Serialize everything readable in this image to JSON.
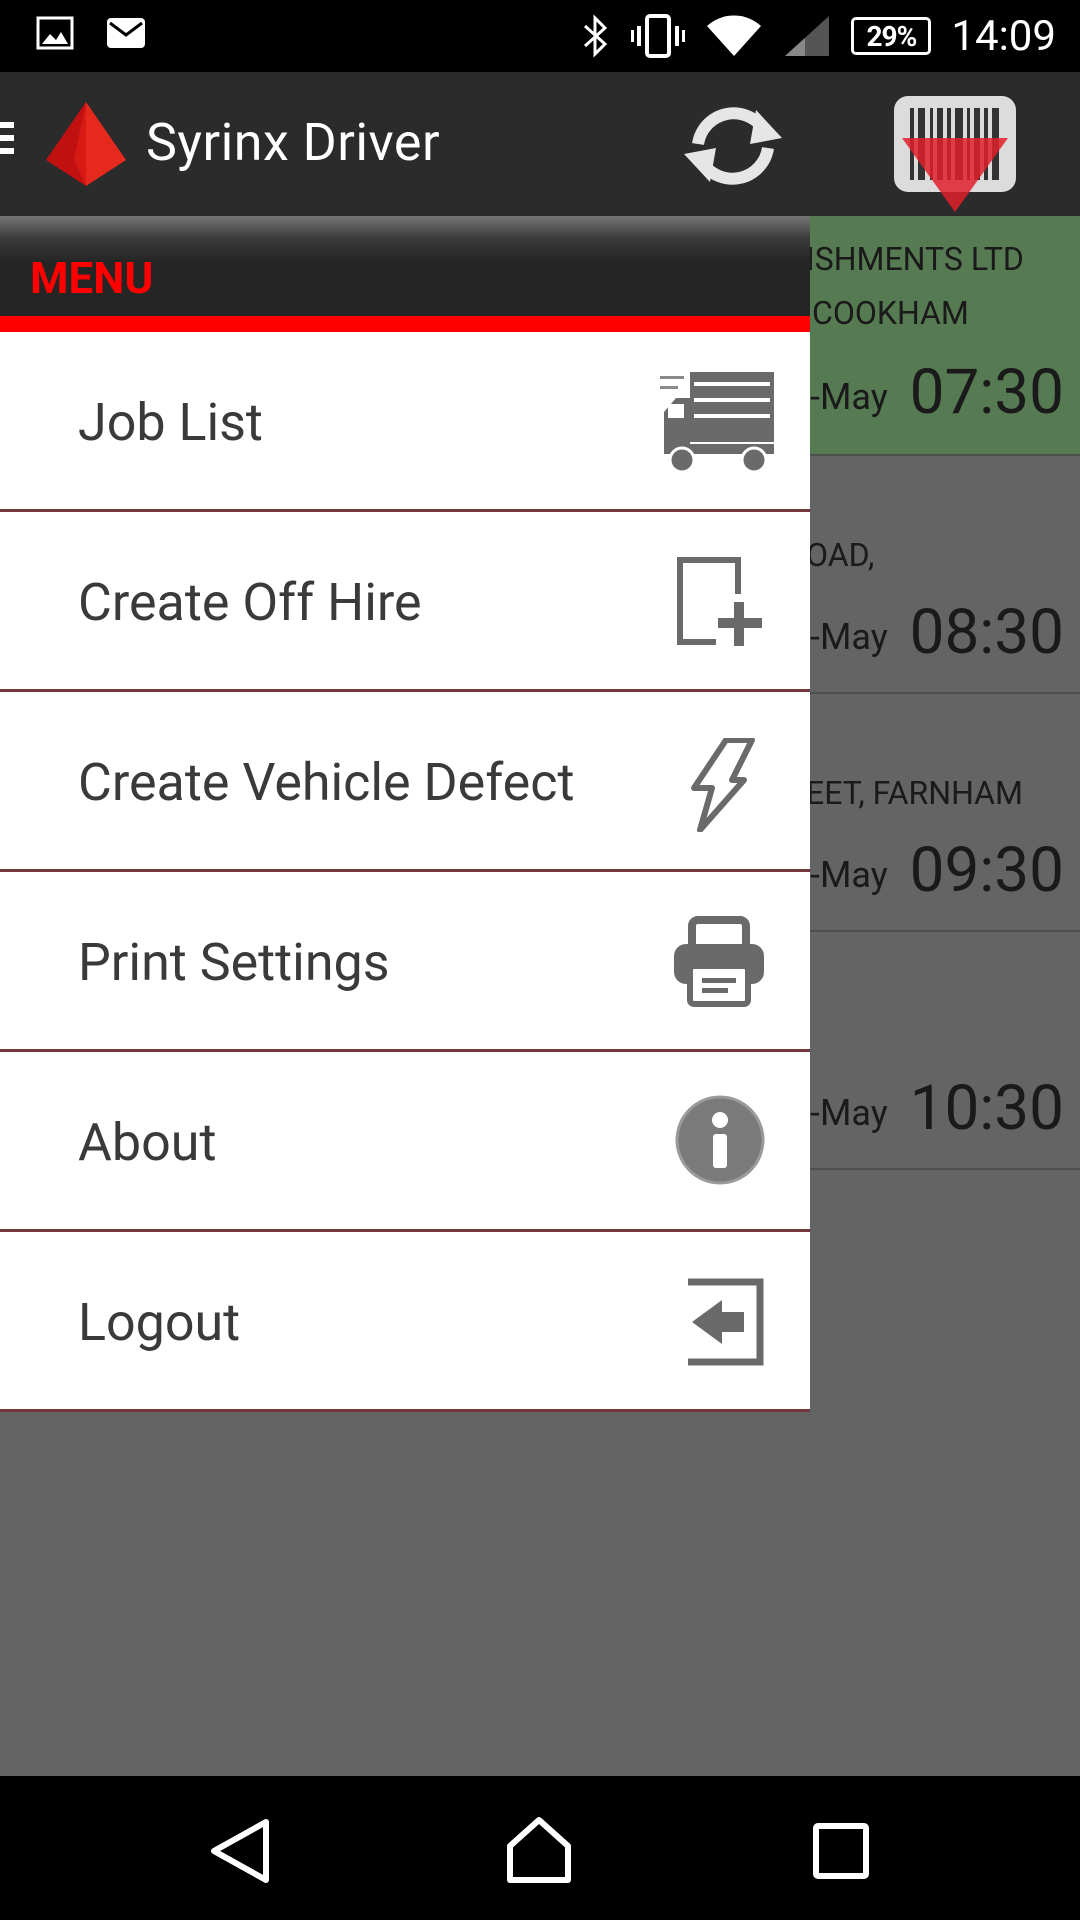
{
  "status_bar": {
    "notification_icons": [
      "image-icon",
      "email-icon"
    ],
    "system_icons": [
      "bluetooth-icon",
      "vibrate-icon",
      "wifi-icon",
      "cellular-signal-icon"
    ],
    "battery": "29%",
    "time": "14:09"
  },
  "action_bar": {
    "title": "Syrinx Driver",
    "actions": [
      "sync-icon",
      "barcode-scanner-icon"
    ],
    "logo": "pyramid-logo-icon"
  },
  "drawer": {
    "header": "MENU",
    "items": [
      {
        "label": "Job List",
        "icon": "truck-icon"
      },
      {
        "label": "Create Off Hire",
        "icon": "add-document-icon"
      },
      {
        "label": "Create Vehicle Defect",
        "icon": "lightning-icon"
      },
      {
        "label": "Print Settings",
        "icon": "printer-icon"
      },
      {
        "label": "About",
        "icon": "info-icon"
      },
      {
        "label": "Logout",
        "icon": "logout-icon"
      }
    ]
  },
  "background_jobs": [
    {
      "line1": "ISHMENTS LTD",
      "line2": "COOKHAM",
      "date": "-May",
      "time": "07:30"
    },
    {
      "line1": "OAD,",
      "line2": "",
      "date": "-May",
      "time": "08:30"
    },
    {
      "line1": "EET, FARNHAM",
      "line2": "",
      "date": "-May",
      "time": "09:30"
    },
    {
      "line1": "",
      "line2": "",
      "date": "-May",
      "time": "10:30"
    }
  ],
  "nav_bar": {
    "buttons": [
      "back-icon",
      "home-icon",
      "recents-icon"
    ]
  },
  "colors": {
    "accent": "#ff0000",
    "action_bar": "#2b2b2b",
    "active_job": "#567a52",
    "overlay": "#646464",
    "menu_divider": "#73383c"
  }
}
